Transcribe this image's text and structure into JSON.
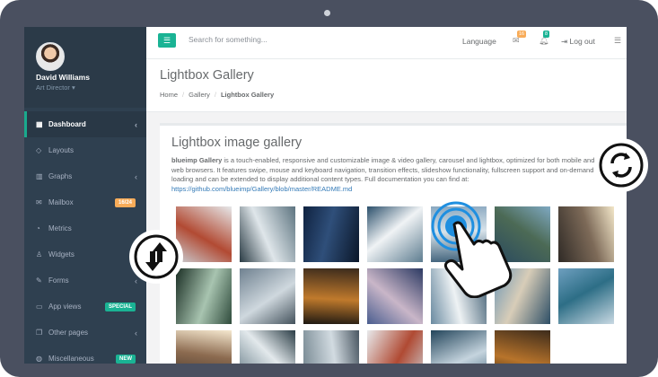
{
  "profile": {
    "name": "David Williams",
    "role": "Art Director ▾"
  },
  "sidebar": {
    "items": [
      {
        "label": "Dashboard",
        "icon": "th-large-icon",
        "glyph": "▦",
        "chevron": true,
        "active": true
      },
      {
        "label": "Layouts",
        "icon": "diamond-icon",
        "glyph": "◇"
      },
      {
        "label": "Graphs",
        "icon": "bar-chart-icon",
        "glyph": "▥",
        "chevron": true
      },
      {
        "label": "Mailbox",
        "icon": "envelope-icon",
        "glyph": "✉",
        "badge": "16/24",
        "badge_style": "warn"
      },
      {
        "label": "Metrics",
        "icon": "pie-chart-icon",
        "glyph": "◔"
      },
      {
        "label": "Widgets",
        "icon": "flask-icon",
        "glyph": "♙"
      },
      {
        "label": "Forms",
        "icon": "edit-icon",
        "glyph": "✎",
        "chevron": true
      },
      {
        "label": "App views",
        "icon": "desktop-icon",
        "glyph": "▭",
        "badge": "SPECIAL",
        "badge_style": "prim"
      },
      {
        "label": "Other pages",
        "icon": "files-icon",
        "glyph": "❐",
        "chevron": true
      },
      {
        "label": "Miscellaneous",
        "icon": "globe-icon",
        "glyph": "◍",
        "badge": "NEW",
        "badge_style": "prim"
      }
    ]
  },
  "topbar": {
    "search_placeholder": "Search for something...",
    "language": "Language",
    "messages_count": "16",
    "alerts_count": "8",
    "logout": "Log out"
  },
  "page": {
    "title": "Lightbox Gallery",
    "breadcrumb": [
      "Home",
      "Gallery",
      "Lightbox Gallery"
    ]
  },
  "ibox": {
    "title": "Lightbox image gallery",
    "text_bold": "blueimp Gallery",
    "text": " is a touch-enabled, responsive and customizable image & video gallery, carousel and lightbox, optimized for both mobile and desktop web browsers. It features swipe, mouse and keyboard navigation, transition effects, slideshow functionality, fullscreen support and on-demand content loading and can be extended to display additional content types. Full documentation you can find at: ",
    "link": "https://github.com/blueimp/Gallery/blob/master/README.md"
  },
  "gallery": [
    {
      "name": "bridge-fog",
      "colors": [
        "#c9cdd2",
        "#b24a33",
        "#e6e8ea"
      ]
    },
    {
      "name": "waves-aerial",
      "colors": [
        "#2a3b44",
        "#dfe6ea",
        "#5d7480"
      ]
    },
    {
      "name": "dark-sky",
      "colors": [
        "#0f2240",
        "#2f4f7a",
        "#0a1628"
      ]
    },
    {
      "name": "wave-splash",
      "colors": [
        "#2b4f6b",
        "#f0f3f5",
        "#5e7d90"
      ]
    },
    {
      "name": "sea-sky",
      "colors": [
        "#8aa8c0",
        "#d8e3ea",
        "#3d5f78"
      ]
    },
    {
      "name": "coast-rocks",
      "colors": [
        "#7fa9c2",
        "#4c6a55",
        "#2a4a5f"
      ]
    },
    {
      "name": "sunset-silhouette",
      "colors": [
        "#f3e7c9",
        "#7d6a58",
        "#2f2a26"
      ]
    },
    {
      "name": "palm-leaves",
      "colors": [
        "#2f4b3c",
        "#a8c4b0",
        "#1b2f25"
      ]
    },
    {
      "name": "boat-mast",
      "colors": [
        "#44525c",
        "#cfd8de",
        "#6f8190"
      ]
    },
    {
      "name": "tiger",
      "colors": [
        "#1e1812",
        "#c07a2c",
        "#3a2a1c"
      ]
    },
    {
      "name": "mountain-lake",
      "colors": [
        "#4a5d8f",
        "#c9b6c8",
        "#2c3a63"
      ]
    },
    {
      "name": "waves-crash",
      "colors": [
        "#6a8aa0",
        "#eef2f4",
        "#3f5d72"
      ]
    },
    {
      "name": "ocean-cliff",
      "colors": [
        "#6f97b5",
        "#d8cdb8",
        "#2e4f66"
      ]
    },
    {
      "name": "coastline",
      "colors": [
        "#6e9fbf",
        "#2d6e86",
        "#c9d9e3"
      ]
    },
    {
      "name": "sunset-bridge",
      "colors": [
        "#f5e8cf",
        "#8c6b50",
        "#3a2e26"
      ]
    },
    {
      "name": "waves-aerial-2",
      "colors": [
        "#2b3d46",
        "#e3e9ec",
        "#5a717d"
      ]
    },
    {
      "name": "boat-mast-2",
      "colors": [
        "#4a5762",
        "#d2dbe1",
        "#73858f"
      ]
    },
    {
      "name": "bridge-fog-2",
      "colors": [
        "#cbd0d4",
        "#b04a33",
        "#e8eaec"
      ]
    },
    {
      "name": "ocean-waves",
      "colors": [
        "#3c6077",
        "#c5d4de",
        "#22445a"
      ]
    },
    {
      "name": "tiger-2",
      "colors": [
        "#20190f",
        "#b8742b",
        "#3c2b1b"
      ]
    }
  ],
  "overlay": {
    "rotate_icon": "rotate-icon",
    "swap_icon": "swap-vertical-icon",
    "hand_icon": "tap-hand-icon"
  }
}
